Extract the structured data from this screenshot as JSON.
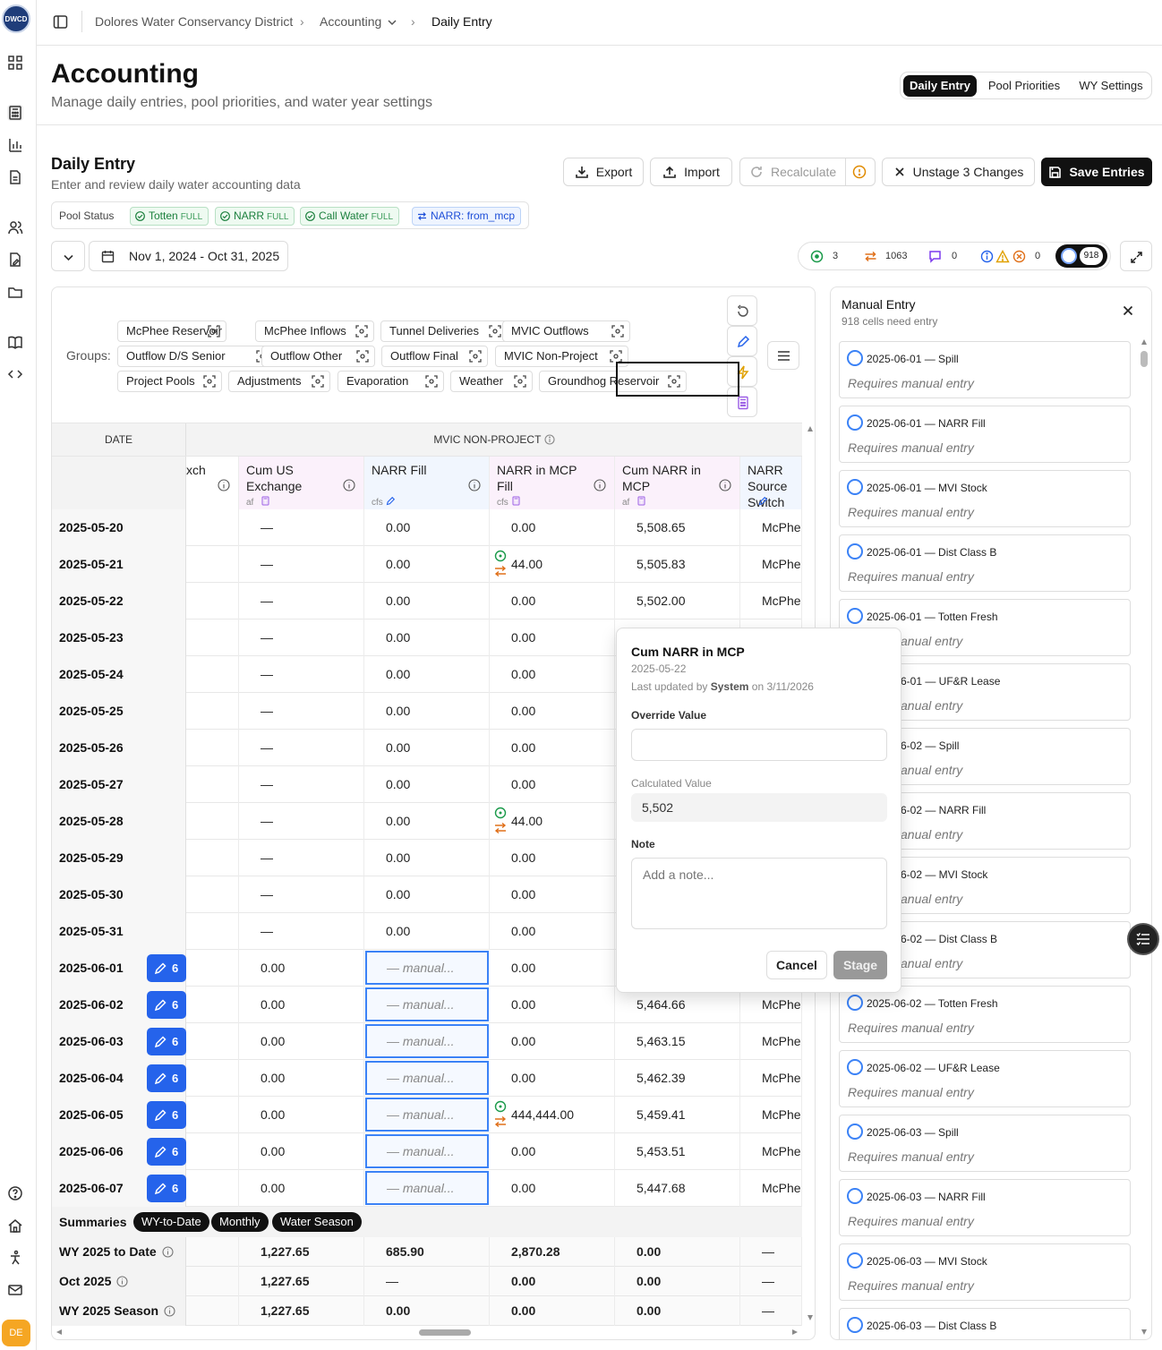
{
  "app": {
    "logo_text": "DWCD",
    "user_initials": "DE"
  },
  "breadcrumb": [
    "Dolores Water Conservancy District",
    "Accounting",
    "Daily Entry"
  ],
  "header": {
    "title": "Accounting",
    "subtitle": "Manage daily entries, pool priorities, and water year settings"
  },
  "tabs": [
    {
      "label": "Daily Entry",
      "active": true
    },
    {
      "label": "Pool Priorities"
    },
    {
      "label": "WY Settings"
    }
  ],
  "section": {
    "title": "Daily Entry",
    "subtitle": "Enter and review daily water accounting data"
  },
  "actions": {
    "export": "Export",
    "import": "Import",
    "recalculate": "Recalculate",
    "unstage": "Unstage 3 Changes",
    "save": "Save Entries"
  },
  "pool_status": {
    "label": "Pool Status",
    "pills": [
      {
        "name": "Totten",
        "status": "FULL"
      },
      {
        "name": "NARR",
        "status": "FULL"
      },
      {
        "name": "Call Water",
        "status": "FULL"
      }
    ],
    "mode": "NARR: from_mcp"
  },
  "date_range": "Nov 1, 2024 - Oct 31, 2025",
  "counters": {
    "ok": "3",
    "swap": "1063",
    "comments": "0",
    "warnings": "0",
    "manual": "918"
  },
  "groups": {
    "label": "Groups:",
    "items": [
      "McPhee Reservoir",
      "McPhee Inflows",
      "Tunnel Deliveries",
      "MVIC Outflows",
      "Outflow D/S Senior",
      "Outflow Other",
      "Outflow Final",
      "MVIC Non-Project",
      "Project Pools",
      "Adjustments",
      "Evaporation",
      "Weather",
      "Groundhog Reservoir"
    ]
  },
  "table": {
    "date_header": "DATE",
    "group_header": "MVIC NON-PROJECT",
    "columns": [
      {
        "label": "xch",
        "unit": ""
      },
      {
        "label": "Cum US Exchange",
        "unit": "af"
      },
      {
        "label": "NARR Fill",
        "unit": "cfs"
      },
      {
        "label": "NARR in MCP Fill",
        "unit": "cfs"
      },
      {
        "label": "Cum NARR in MCP",
        "unit": "af"
      },
      {
        "label": "NARR Source Switch",
        "unit": ""
      }
    ],
    "manual_placeholder": "— manual...",
    "rows": [
      {
        "date": "2025-05-20",
        "c1": "—",
        "c2": "0.00",
        "c3": "0.00",
        "c4": "5,508.65",
        "c5": "McPhee"
      },
      {
        "date": "2025-05-21",
        "c1": "—",
        "c2": "0.00",
        "c3": "44.00",
        "c4": "5,505.83",
        "c5": "McPhee",
        "flag": true
      },
      {
        "date": "2025-05-22",
        "c1": "—",
        "c2": "0.00",
        "c3": "0.00",
        "c4": "5,502.00",
        "c5": "McPhee"
      },
      {
        "date": "2025-05-23",
        "c1": "—",
        "c2": "0.00",
        "c3": "0.00",
        "c4": "",
        "c5": ""
      },
      {
        "date": "2025-05-24",
        "c1": "—",
        "c2": "0.00",
        "c3": "0.00",
        "c4": "",
        "c5": ""
      },
      {
        "date": "2025-05-25",
        "c1": "—",
        "c2": "0.00",
        "c3": "0.00",
        "c4": "",
        "c5": ""
      },
      {
        "date": "2025-05-26",
        "c1": "—",
        "c2": "0.00",
        "c3": "0.00",
        "c4": "",
        "c5": ""
      },
      {
        "date": "2025-05-27",
        "c1": "—",
        "c2": "0.00",
        "c3": "0.00",
        "c4": "",
        "c5": ""
      },
      {
        "date": "2025-05-28",
        "c1": "—",
        "c2": "0.00",
        "c3": "44.00",
        "c4": "",
        "c5": "",
        "flag": true
      },
      {
        "date": "2025-05-29",
        "c1": "—",
        "c2": "0.00",
        "c3": "0.00",
        "c4": "",
        "c5": ""
      },
      {
        "date": "2025-05-30",
        "c1": "—",
        "c2": "0.00",
        "c3": "0.00",
        "c4": "",
        "c5": ""
      },
      {
        "date": "2025-05-31",
        "c1": "—",
        "c2": "0.00",
        "c3": "0.00",
        "c4": "",
        "c5": ""
      },
      {
        "date": "2025-06-01",
        "badge": "6",
        "c1": "0.00",
        "manual": true,
        "c3": "0.00",
        "c4": "",
        "c5": ""
      },
      {
        "date": "2025-06-02",
        "badge": "6",
        "c1": "0.00",
        "manual": true,
        "c3": "0.00",
        "c4": "5,464.66",
        "c5": "McPhee"
      },
      {
        "date": "2025-06-03",
        "badge": "6",
        "c1": "0.00",
        "manual": true,
        "c3": "0.00",
        "c4": "5,463.15",
        "c5": "McPhee"
      },
      {
        "date": "2025-06-04",
        "badge": "6",
        "c1": "0.00",
        "manual": true,
        "c3": "0.00",
        "c4": "5,462.39",
        "c5": "McPhee"
      },
      {
        "date": "2025-06-05",
        "badge": "6",
        "c1": "0.00",
        "manual": true,
        "c3": "444,444.00",
        "c4": "5,459.41",
        "c5": "McPhee",
        "flag": true
      },
      {
        "date": "2025-06-06",
        "badge": "6",
        "c1": "0.00",
        "manual": true,
        "c3": "0.00",
        "c4": "5,453.51",
        "c5": "McPhee"
      },
      {
        "date": "2025-06-07",
        "badge": "6",
        "c1": "0.00",
        "manual": true,
        "c3": "0.00",
        "c4": "5,447.68",
        "c5": "McPhee"
      }
    ],
    "summaries": {
      "label": "Summaries",
      "chips": [
        "WY-to-Date",
        "Monthly",
        "Water Season"
      ],
      "rows": [
        {
          "label": "WY 2025 to Date",
          "values": [
            "1,227.65",
            "685.90",
            "2,870.28",
            "0.00",
            "—"
          ]
        },
        {
          "label": "Oct 2025",
          "values": [
            "1,227.65",
            "—",
            "0.00",
            "0.00",
            "—"
          ]
        },
        {
          "label": "WY 2025 Season",
          "values": [
            "1,227.65",
            "0.00",
            "0.00",
            "0.00",
            "—"
          ]
        }
      ]
    }
  },
  "popover": {
    "title": "Cum NARR in MCP",
    "date": "2025-05-22",
    "updated_prefix": "Last updated by",
    "updated_by": "System",
    "updated_suffix": "on 3/11/2026",
    "override_label": "Override Value",
    "override_value": "",
    "calculated_label": "Calculated Value",
    "calculated_value": "5,502",
    "note_label": "Note",
    "note_placeholder": "Add a note...",
    "cancel": "Cancel",
    "stage": "Stage"
  },
  "manual_panel": {
    "title": "Manual Entry",
    "subtitle": "918 cells need entry",
    "requires": "Requires manual entry",
    "requires_partial": "anual entry",
    "items": [
      "2025-06-01 — Spill",
      "2025-06-01 — NARR Fill",
      "2025-06-01 — MVI Stock",
      "2025-06-01 — Dist Class B",
      "2025-06-01 — Totten Fresh",
      "6-01 — UF&R Lease",
      "6-02 — Spill",
      "6-02 — NARR Fill",
      "6-02 — MVI Stock",
      "6-02 — Dist Class B",
      "2025-06-02 — Totten Fresh",
      "2025-06-02 — UF&R Lease",
      "2025-06-03 — Spill",
      "2025-06-03 — NARR Fill",
      "2025-06-03 — MVI Stock",
      "2025-06-03 — Dist Class B"
    ]
  }
}
